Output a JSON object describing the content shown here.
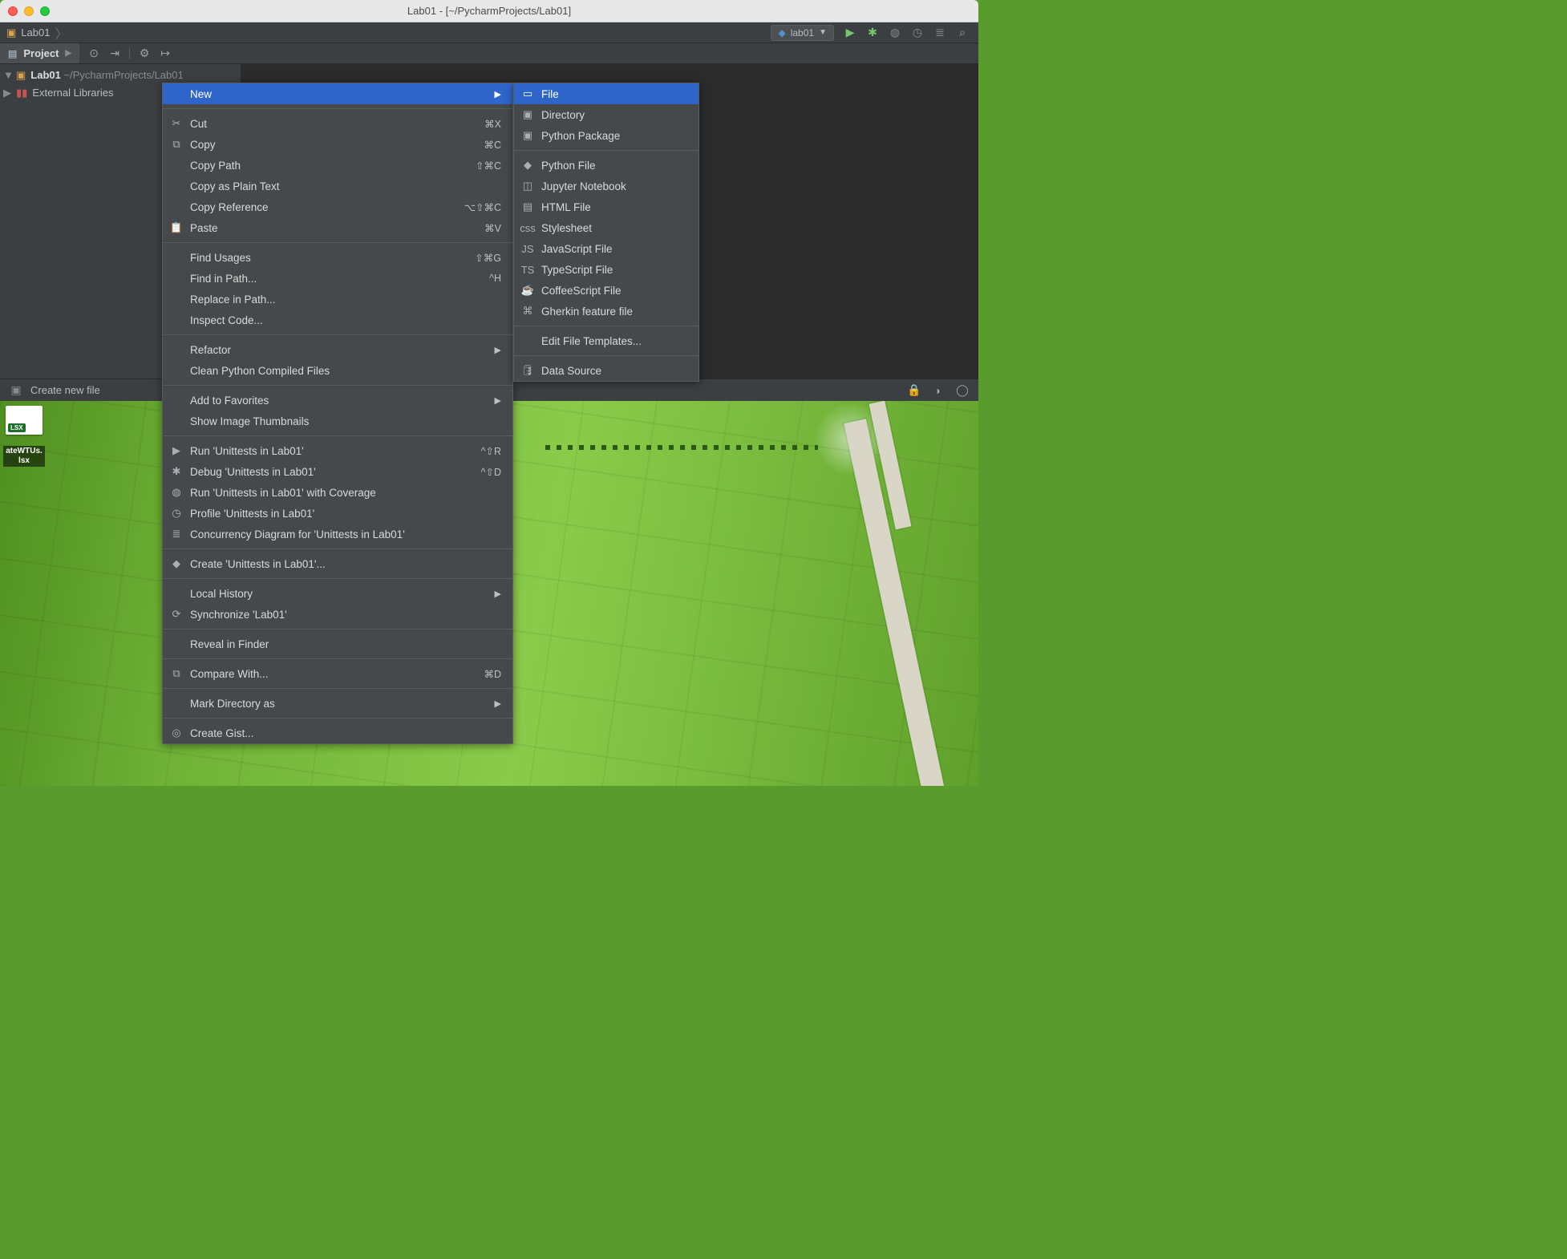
{
  "window": {
    "title": "Lab01 - [~/PycharmProjects/Lab01]"
  },
  "breadcrumb": {
    "project": "Lab01"
  },
  "toolbar": {
    "run_config_label": "lab01",
    "project_tab": "Project"
  },
  "project_tree": {
    "root_name": "Lab01",
    "root_path": "~/PycharmProjects/Lab01",
    "external_libs": "External Libraries"
  },
  "statusbar": {
    "hint": "Create new file"
  },
  "desktop_icons": {
    "xlsx_tag": "LSX",
    "file2_line1": "ateWTUs.",
    "file2_line2": "lsx"
  },
  "context_menu": {
    "items": [
      {
        "label": "New",
        "submenu": true,
        "highlight": true
      },
      "---",
      {
        "icon": "scissors",
        "label": "Cut",
        "shortcut": "⌘X"
      },
      {
        "icon": "copy",
        "label": "Copy",
        "shortcut": "⌘C"
      },
      {
        "label": "Copy Path",
        "shortcut": "⇧⌘C"
      },
      {
        "label": "Copy as Plain Text"
      },
      {
        "label": "Copy Reference",
        "shortcut": "⌥⇧⌘C"
      },
      {
        "icon": "paste",
        "label": "Paste",
        "shortcut": "⌘V"
      },
      "---",
      {
        "label": "Find Usages",
        "shortcut": "⇧⌘G"
      },
      {
        "label": "Find in Path...",
        "shortcut": "^H"
      },
      {
        "label": "Replace in Path..."
      },
      {
        "label": "Inspect Code..."
      },
      "---",
      {
        "label": "Refactor",
        "submenu": true
      },
      {
        "label": "Clean Python Compiled Files"
      },
      "---",
      {
        "label": "Add to Favorites",
        "submenu": true
      },
      {
        "label": "Show Image Thumbnails"
      },
      "---",
      {
        "icon": "run",
        "label": "Run 'Unittests in Lab01'",
        "shortcut": "^⇧R"
      },
      {
        "icon": "bug",
        "label": "Debug 'Unittests in Lab01'",
        "shortcut": "^⇧D"
      },
      {
        "icon": "cov",
        "label": "Run 'Unittests in Lab01' with Coverage"
      },
      {
        "icon": "prof",
        "label": "Profile 'Unittests in Lab01'"
      },
      {
        "icon": "conc",
        "label": "Concurrency Diagram for  'Unittests in Lab01'"
      },
      "---",
      {
        "icon": "py",
        "label": "Create 'Unittests in Lab01'..."
      },
      "---",
      {
        "label": "Local History",
        "submenu": true
      },
      {
        "icon": "sync",
        "label": "Synchronize 'Lab01'"
      },
      "---",
      {
        "label": "Reveal in Finder"
      },
      "---",
      {
        "icon": "cmp",
        "label": "Compare With...",
        "shortcut": "⌘D"
      },
      "---",
      {
        "label": "Mark Directory as",
        "submenu": true
      },
      "---",
      {
        "icon": "gist",
        "label": "Create Gist..."
      }
    ]
  },
  "new_submenu": {
    "items": [
      {
        "icon": "file",
        "label": "File",
        "highlight": true
      },
      {
        "icon": "dir",
        "label": "Directory"
      },
      {
        "icon": "dir",
        "label": "Python Package"
      },
      "---",
      {
        "icon": "py",
        "label": "Python File"
      },
      {
        "icon": "jn",
        "label": "Jupyter Notebook"
      },
      {
        "icon": "html",
        "label": "HTML File"
      },
      {
        "icon": "css",
        "label": "Stylesheet"
      },
      {
        "icon": "js",
        "label": "JavaScript File"
      },
      {
        "icon": "ts",
        "label": "TypeScript File"
      },
      {
        "icon": "cof",
        "label": "CoffeeScript File"
      },
      {
        "icon": "gh",
        "label": "Gherkin feature file"
      },
      "---",
      {
        "label": "Edit File Templates..."
      },
      "---",
      {
        "icon": "db",
        "label": "Data Source"
      }
    ]
  }
}
